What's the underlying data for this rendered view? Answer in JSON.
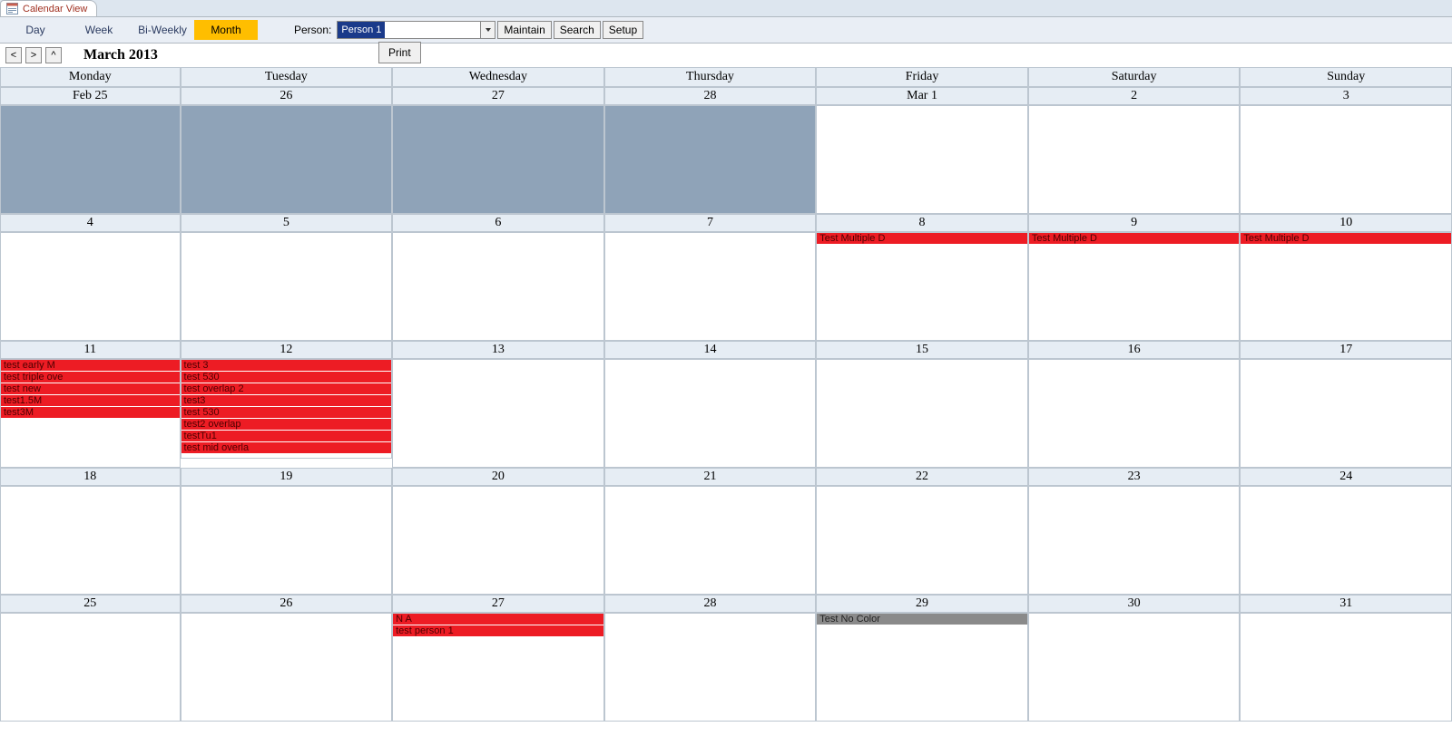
{
  "tab": {
    "title": "Calendar View"
  },
  "toolbar": {
    "views": {
      "day": "Day",
      "week": "Week",
      "biweekly": "Bi-Weekly",
      "month": "Month"
    },
    "active_view": "month",
    "person_label": "Person:",
    "person_value": "Person 1",
    "maintain": "Maintain",
    "search": "Search",
    "setup": "Setup"
  },
  "nav": {
    "prev": "<",
    "next": ">",
    "up": "^"
  },
  "title": "March 2013",
  "print": "Print",
  "dow": [
    "Monday",
    "Tuesday",
    "Wednesday",
    "Thursday",
    "Friday",
    "Saturday",
    "Sunday"
  ],
  "weeks": [
    {
      "dates": [
        "Feb 25",
        "26",
        "27",
        "28",
        "Mar 1",
        "2",
        "3"
      ],
      "prev_mask": [
        true,
        true,
        true,
        true,
        false,
        false,
        false
      ],
      "cells": [
        [],
        [],
        [],
        [],
        [],
        [],
        []
      ]
    },
    {
      "dates": [
        "4",
        "5",
        "6",
        "7",
        "8",
        "9",
        "10"
      ],
      "prev_mask": [
        false,
        false,
        false,
        false,
        false,
        false,
        false
      ],
      "cells": [
        [],
        [],
        [],
        [],
        [
          {
            "t": "Test Multiple D",
            "c": "red"
          }
        ],
        [
          {
            "t": "Test Multiple D",
            "c": "red"
          }
        ],
        [
          {
            "t": "Test Multiple D",
            "c": "red"
          }
        ]
      ]
    },
    {
      "dates": [
        "11",
        "12",
        "13",
        "14",
        "15",
        "16",
        "17"
      ],
      "prev_mask": [
        false,
        false,
        false,
        false,
        false,
        false,
        false
      ],
      "cells": [
        [
          {
            "t": "test early M",
            "c": "red"
          },
          {
            "t": "test triple ove",
            "c": "red"
          },
          {
            "t": "test new",
            "c": "red"
          },
          {
            "t": "test1.5M",
            "c": "red"
          },
          {
            "t": "test3M",
            "c": "red"
          }
        ],
        [
          {
            "t": "test 3",
            "c": "red"
          },
          {
            "t": "test 530",
            "c": "red"
          },
          {
            "t": "test overlap 2",
            "c": "red"
          },
          {
            "t": "test3",
            "c": "red"
          },
          {
            "t": "test 530",
            "c": "red"
          },
          {
            "t": "test2 overlap",
            "c": "red"
          },
          {
            "t": "testTu1",
            "c": "red"
          },
          {
            "t": "test mid overla",
            "c": "red"
          }
        ],
        [],
        [],
        [],
        [],
        []
      ]
    },
    {
      "dates": [
        "18",
        "19",
        "20",
        "21",
        "22",
        "23",
        "24"
      ],
      "prev_mask": [
        false,
        false,
        false,
        false,
        false,
        false,
        false
      ],
      "cells": [
        [],
        [],
        [],
        [],
        [],
        [],
        []
      ]
    },
    {
      "dates": [
        "25",
        "26",
        "27",
        "28",
        "29",
        "30",
        "31"
      ],
      "prev_mask": [
        false,
        false,
        false,
        false,
        false,
        false,
        false
      ],
      "cells": [
        [],
        [],
        [
          {
            "t": "N A",
            "c": "red"
          },
          {
            "t": "test person 1",
            "c": "red"
          }
        ],
        [],
        [
          {
            "t": "Test No Color",
            "c": "gray"
          }
        ],
        [],
        []
      ]
    }
  ]
}
